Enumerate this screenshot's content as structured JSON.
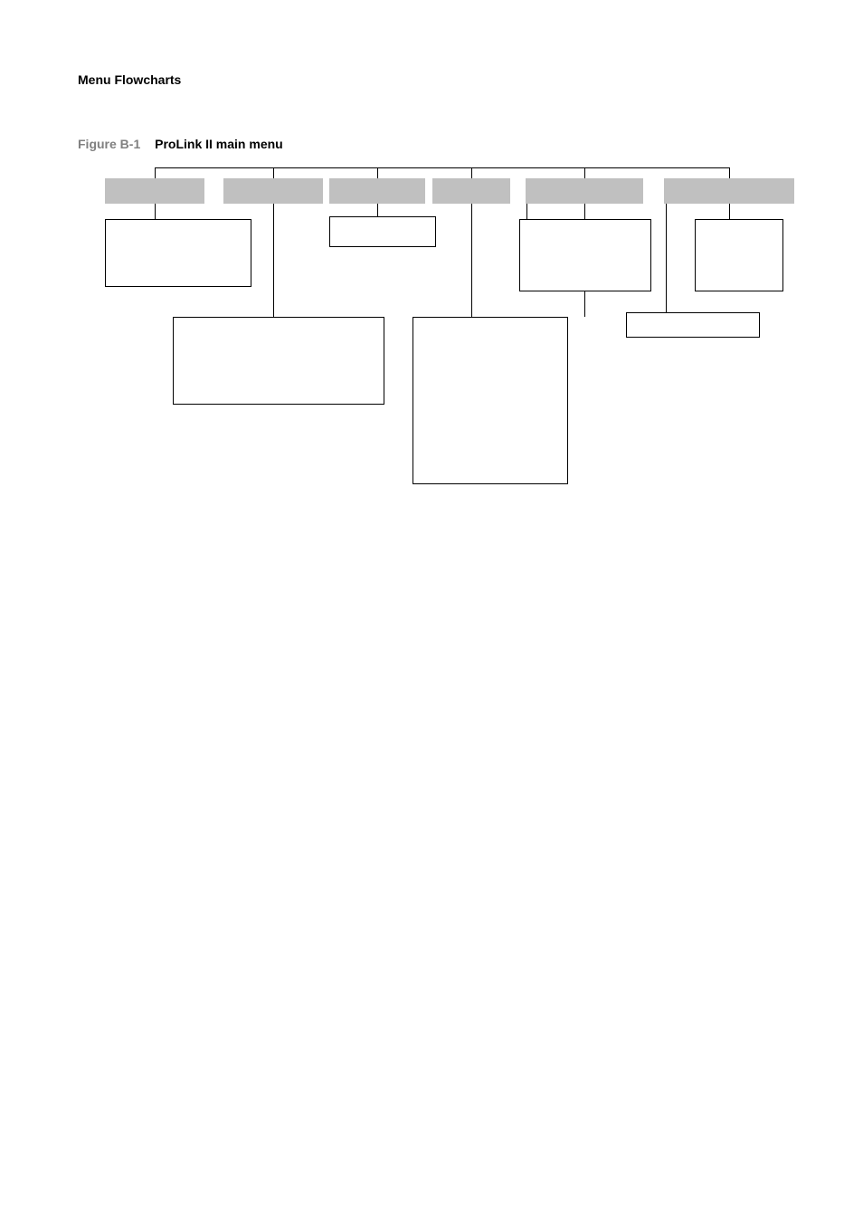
{
  "header": "Menu Flowcharts",
  "figure": {
    "label": "Figure B-1",
    "title": "ProLink II main menu"
  }
}
